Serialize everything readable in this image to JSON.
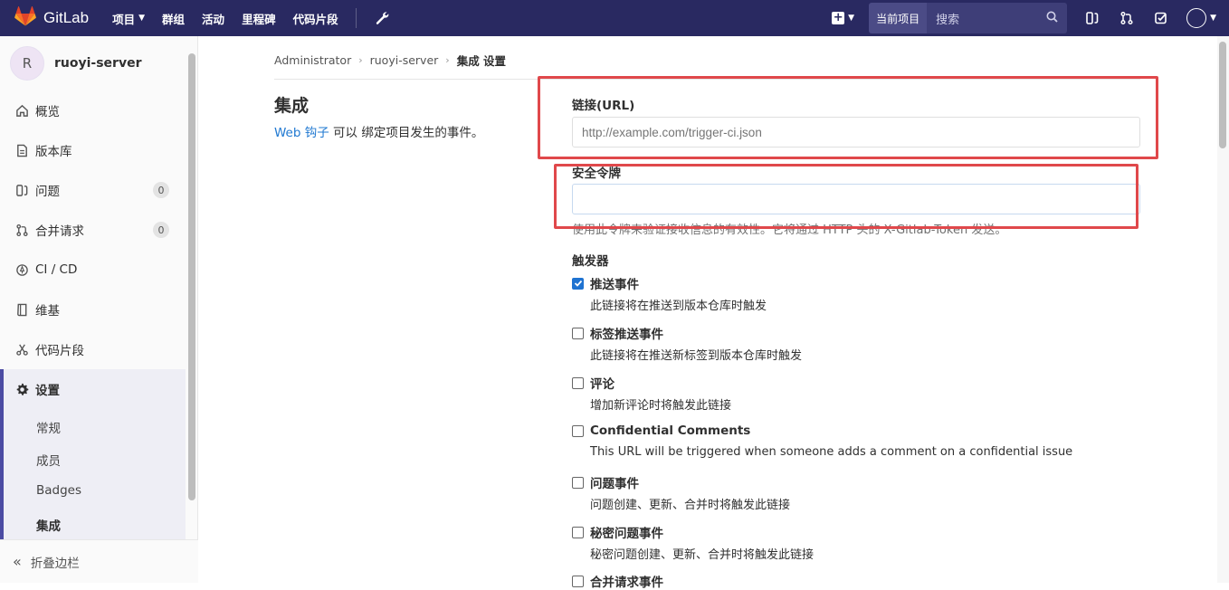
{
  "navbar": {
    "brand": "GitLab",
    "links": [
      {
        "label": "项目",
        "has_caret": true
      },
      {
        "label": "群组",
        "has_caret": false
      },
      {
        "label": "活动",
        "has_caret": false
      },
      {
        "label": "里程碑",
        "has_caret": false
      },
      {
        "label": "代码片段",
        "has_caret": false
      }
    ],
    "scope_label": "当前项目",
    "search_placeholder": "搜索",
    "icons": [
      "wrench-icon",
      "plus-square-icon",
      "search-icon",
      "issues-icon",
      "merge-request-icon",
      "todo-icon",
      "avatar-icon"
    ]
  },
  "sidebar": {
    "project_initial": "R",
    "project_name": "ruoyi-server",
    "items": [
      {
        "label": "概览",
        "icon": "home-icon"
      },
      {
        "label": "版本库",
        "icon": "repository-icon"
      },
      {
        "label": "问题",
        "icon": "issues-icon",
        "badge": "0"
      },
      {
        "label": "合并请求",
        "icon": "merge-request-icon",
        "badge": "0"
      },
      {
        "label": "CI / CD",
        "icon": "rocket-icon"
      },
      {
        "label": "维基",
        "icon": "book-icon"
      },
      {
        "label": "代码片段",
        "icon": "snippet-icon"
      },
      {
        "label": "设置",
        "icon": "gear-icon",
        "active": true
      }
    ],
    "sub_items": [
      {
        "label": "常规"
      },
      {
        "label": "成员"
      },
      {
        "label": "Badges"
      },
      {
        "label": "集成",
        "active": true
      }
    ],
    "collapse_label": "折叠边栏"
  },
  "breadcrumb": {
    "items": [
      "Administrator",
      "ruoyi-server"
    ],
    "current": "集成 设置"
  },
  "section": {
    "title": "集成",
    "desc_link": "Web 钩子",
    "desc_rest": " 可以 绑定项目发生的事件。"
  },
  "form": {
    "url_label": "链接(URL)",
    "url_placeholder": "http://example.com/trigger-ci.json",
    "token_label": "安全令牌",
    "token_value": "",
    "token_help": "使用此令牌来验证接收信息的有效性。它将通过 HTTP 头的 X-Gitlab-Token 发送。",
    "triggers_label": "触发器",
    "triggers": [
      {
        "label": "推送事件",
        "help": "此链接将在推送到版本仓库时触发",
        "checked": true
      },
      {
        "label": "标签推送事件",
        "help": "此链接将在推送新标签到版本仓库时触发",
        "checked": false
      },
      {
        "label": "评论",
        "help": "增加新评论时将触发此链接",
        "checked": false
      },
      {
        "label": "Confidential Comments",
        "help": "This URL will be triggered when someone adds a comment on a confidential issue",
        "checked": false
      },
      {
        "label": "问题事件",
        "help": "问题创建、更新、合并时将触发此链接",
        "checked": false
      },
      {
        "label": "秘密问题事件",
        "help": "秘密问题创建、更新、合并时将触发此链接",
        "checked": false
      },
      {
        "label": "合并请求事件",
        "help": "",
        "checked": false
      }
    ]
  },
  "colors": {
    "navbar_bg": "#292961",
    "accent": "#4b4ba3",
    "link": "#1f78d1",
    "highlight": "#e0484b"
  }
}
